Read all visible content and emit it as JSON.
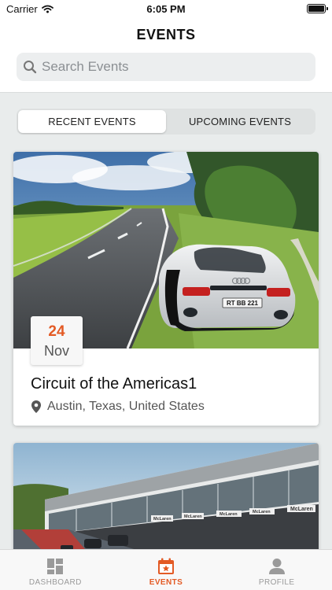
{
  "status_bar": {
    "carrier": "Carrier",
    "time": "6:05 PM",
    "wifi_icon": "wifi-icon",
    "battery_icon": "battery-icon"
  },
  "header": {
    "title": "EVENTS"
  },
  "search": {
    "placeholder": "Search Events",
    "icon": "search-icon"
  },
  "segments": [
    {
      "label": "RECENT EVENTS",
      "selected": true
    },
    {
      "label": "UPCOMING EVENTS",
      "selected": false
    }
  ],
  "events": [
    {
      "day": "24",
      "month": "Nov",
      "name": "Circuit of the Americas1",
      "location": "Austin, Texas, United States",
      "location_icon": "map-pin-icon",
      "plate": "RT BB 221",
      "brand": "audi"
    },
    {
      "brands": [
        "McLaren",
        "McLaren",
        "McLaren",
        "McLaren",
        "McLaren"
      ]
    }
  ],
  "tabbar": [
    {
      "label": "DASHBOARD",
      "icon": "dashboard-icon",
      "active": false
    },
    {
      "label": "EVENTS",
      "icon": "calendar-star-icon",
      "active": true
    },
    {
      "label": "PROFILE",
      "icon": "profile-icon",
      "active": false
    }
  ],
  "colors": {
    "accent": "#e35a24",
    "background": "#e9ecec"
  }
}
